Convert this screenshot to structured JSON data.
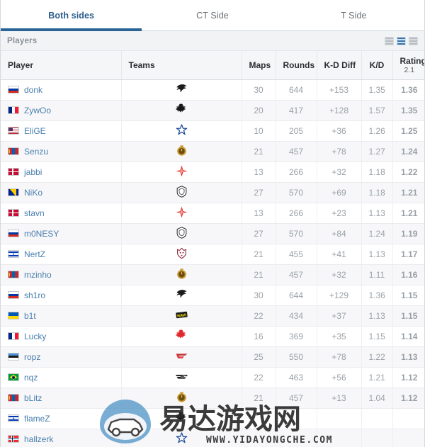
{
  "tabs": [
    {
      "label": "Both sides",
      "active": true
    },
    {
      "label": "CT Side",
      "active": false
    },
    {
      "label": "T Side",
      "active": false
    }
  ],
  "section": {
    "title": "Players",
    "view_toggles": [
      {
        "name": "compact-view",
        "active": false
      },
      {
        "name": "detailed-view",
        "active": true
      },
      {
        "name": "list-view",
        "active": false
      }
    ]
  },
  "colors": {
    "accent": "#2a6496",
    "link": "#4a7fae",
    "kd_diff_green": "#4bb24b",
    "rating_green": "#0f9d0f",
    "header_bg": "#f5f6f7",
    "row_alt_bg": "#f7f7f9",
    "players_bar_bg": "#f2f3f5"
  },
  "table": {
    "columns": [
      {
        "key": "player",
        "label": "Player",
        "align": "left"
      },
      {
        "key": "teams",
        "label": "Teams",
        "align": "left"
      },
      {
        "key": "maps",
        "label": "Maps",
        "align": "center"
      },
      {
        "key": "rounds",
        "label": "Rounds",
        "align": "center"
      },
      {
        "key": "kddiff",
        "label": "K-D Diff",
        "align": "center"
      },
      {
        "key": "kd",
        "label": "K/D",
        "align": "center"
      },
      {
        "key": "rating",
        "label": "Rating",
        "sub": "2.1",
        "align": "center"
      }
    ],
    "rows": [
      {
        "player": "donk",
        "flag": "ru",
        "country": "Russia",
        "team": "spirit",
        "maps": "30",
        "rounds": "644",
        "kddiff": "+153",
        "kd": "1.35",
        "rating": "1.36"
      },
      {
        "player": "ZywOo",
        "flag": "fr",
        "country": "France",
        "team": "vitality",
        "maps": "20",
        "rounds": "417",
        "kddiff": "+128",
        "kd": "1.57",
        "rating": "1.35"
      },
      {
        "player": "EliGE",
        "flag": "us",
        "country": "United States",
        "team": "complexity",
        "maps": "10",
        "rounds": "205",
        "kddiff": "+36",
        "kd": "1.26",
        "rating": "1.25"
      },
      {
        "player": "Senzu",
        "flag": "mn",
        "country": "Mongolia",
        "team": "mongolz",
        "maps": "21",
        "rounds": "457",
        "kddiff": "+78",
        "kd": "1.27",
        "rating": "1.24"
      },
      {
        "player": "jabbi",
        "flag": "dk",
        "country": "Denmark",
        "team": "astralis",
        "maps": "13",
        "rounds": "266",
        "kddiff": "+32",
        "kd": "1.18",
        "rating": "1.22"
      },
      {
        "player": "NiKo",
        "flag": "ba",
        "country": "Bosnia and Herzegovina",
        "team": "g2",
        "maps": "27",
        "rounds": "570",
        "kddiff": "+69",
        "kd": "1.18",
        "rating": "1.21"
      },
      {
        "player": "stavn",
        "flag": "dk",
        "country": "Denmark",
        "team": "astralis",
        "maps": "13",
        "rounds": "266",
        "kddiff": "+23",
        "kd": "1.13",
        "rating": "1.21"
      },
      {
        "player": "m0NESY",
        "flag": "ru",
        "country": "Russia",
        "team": "g2",
        "maps": "27",
        "rounds": "570",
        "kddiff": "+84",
        "kd": "1.24",
        "rating": "1.19"
      },
      {
        "player": "NertZ",
        "flag": "il",
        "country": "Israel",
        "team": "heroic",
        "maps": "21",
        "rounds": "455",
        "kddiff": "+41",
        "kd": "1.13",
        "rating": "1.17"
      },
      {
        "player": "mzinho",
        "flag": "mn",
        "country": "Mongolia",
        "team": "mongolz",
        "maps": "21",
        "rounds": "457",
        "kddiff": "+32",
        "kd": "1.11",
        "rating": "1.16"
      },
      {
        "player": "sh1ro",
        "flag": "ru",
        "country": "Russia",
        "team": "spirit",
        "maps": "30",
        "rounds": "644",
        "kddiff": "+129",
        "kd": "1.36",
        "rating": "1.15"
      },
      {
        "player": "b1t",
        "flag": "ua",
        "country": "Ukraine",
        "team": "navi",
        "maps": "22",
        "rounds": "434",
        "kddiff": "+37",
        "kd": "1.13",
        "rating": "1.15"
      },
      {
        "player": "Lucky",
        "flag": "fr",
        "country": "France",
        "team": "vitality-r",
        "maps": "16",
        "rounds": "369",
        "kddiff": "+35",
        "kd": "1.15",
        "rating": "1.14"
      },
      {
        "player": "ropz",
        "flag": "ee",
        "country": "Estonia",
        "team": "faze",
        "maps": "25",
        "rounds": "550",
        "kddiff": "+78",
        "kd": "1.22",
        "rating": "1.13"
      },
      {
        "player": "nqz",
        "flag": "br",
        "country": "Brazil",
        "team": "furia",
        "maps": "22",
        "rounds": "463",
        "kddiff": "+56",
        "kd": "1.21",
        "rating": "1.12"
      },
      {
        "player": "bLitz",
        "flag": "mn",
        "country": "Mongolia",
        "team": "mongolz",
        "maps": "21",
        "rounds": "457",
        "kddiff": "+13",
        "kd": "1.04",
        "rating": "1.12"
      },
      {
        "player": "flameZ",
        "flag": "il",
        "country": "Israel",
        "team": "vitality",
        "maps": "",
        "rounds": "",
        "kddiff": "",
        "kd": "",
        "rating": ""
      },
      {
        "player": "hallzerk",
        "flag": "no",
        "country": "Norway",
        "team": "complexity",
        "maps": "",
        "rounds": "",
        "kddiff": "",
        "kd": "",
        "rating": ""
      }
    ]
  },
  "watermark": {
    "text": "易达游戏网",
    "url": "WWW.YIDAYONGCHE.COM"
  }
}
